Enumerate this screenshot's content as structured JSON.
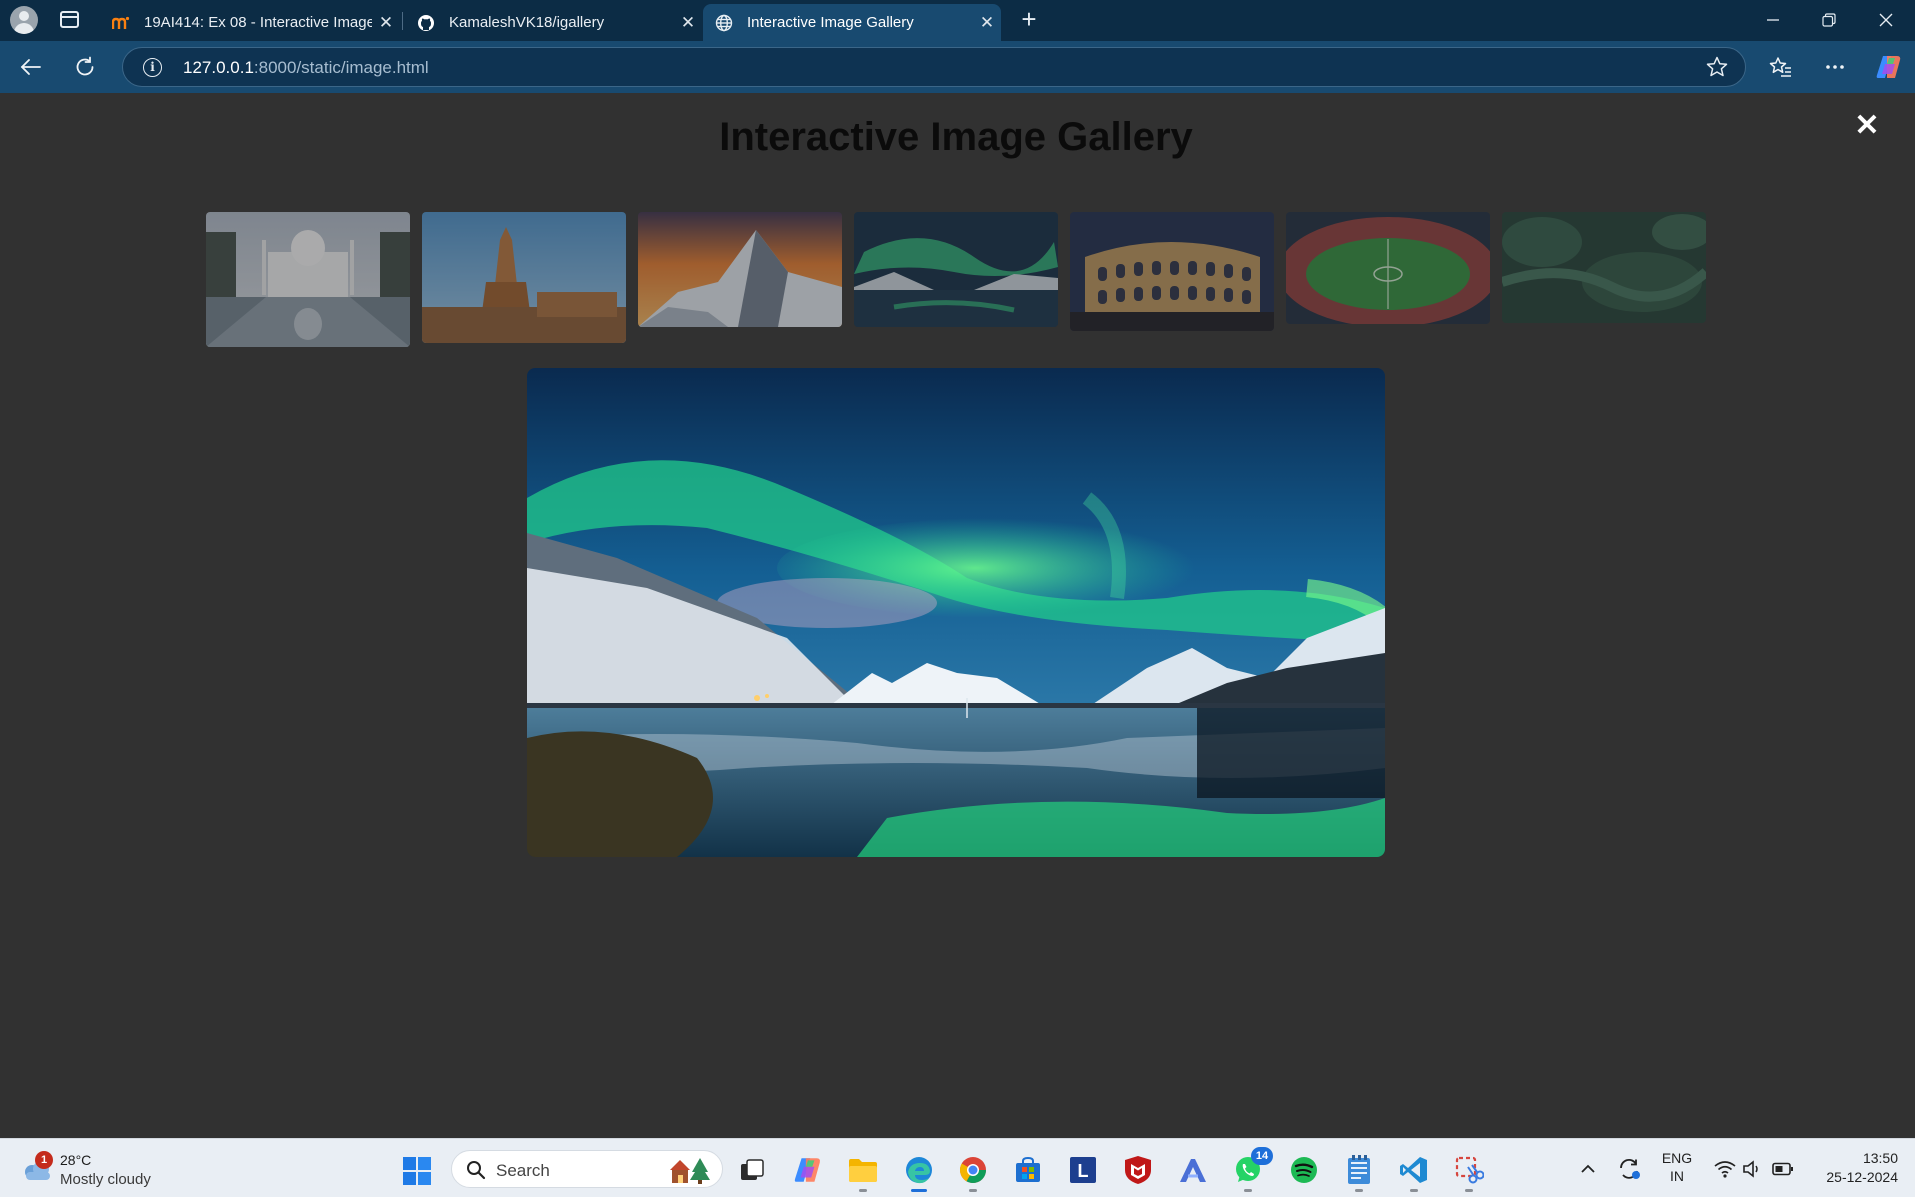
{
  "browser": {
    "tabs": [
      {
        "title": "19AI414: Ex 08 - Interactive Image",
        "favicon": "moodle-icon"
      },
      {
        "title": "KamaleshVK18/igallery",
        "favicon": "github-icon"
      },
      {
        "title": "Interactive Image Gallery",
        "favicon": "globe-icon",
        "active": true
      }
    ],
    "url_host": "127.0.0.1",
    "url_rest": ":8000/static/image.html"
  },
  "page": {
    "title": "Interactive Image Gallery",
    "close_symbol": "✕",
    "thumbnails": [
      {
        "subject": "Taj Mahal"
      },
      {
        "subject": "Temple tower"
      },
      {
        "subject": "Mountain peak at sunset"
      },
      {
        "subject": "Northern lights over fjord"
      },
      {
        "subject": "Colosseum at night"
      },
      {
        "subject": "Football stadium"
      },
      {
        "subject": "Aerial forest"
      }
    ],
    "selected_index": 3
  },
  "taskbar": {
    "weather": {
      "badge": "1",
      "temp": "28°C",
      "condition": "Mostly cloudy"
    },
    "search_placeholder": "Search",
    "apps": [
      "task-view",
      "copilot",
      "file-explorer",
      "edge",
      "chrome",
      "store",
      "lens-l",
      "mcafee",
      "app-a",
      "whatsapp",
      "spotify",
      "notepad",
      "vscode",
      "snipping-tool"
    ],
    "whatsapp_badge": "14",
    "lang_line1": "ENG",
    "lang_line2": "IN",
    "time": "13:50",
    "date": "25-12-2024"
  },
  "colors": {
    "titlebar": "#0c2c45",
    "toolbar": "#184a70",
    "page_bg": "#313131",
    "taskbar": "#e9eef4"
  }
}
